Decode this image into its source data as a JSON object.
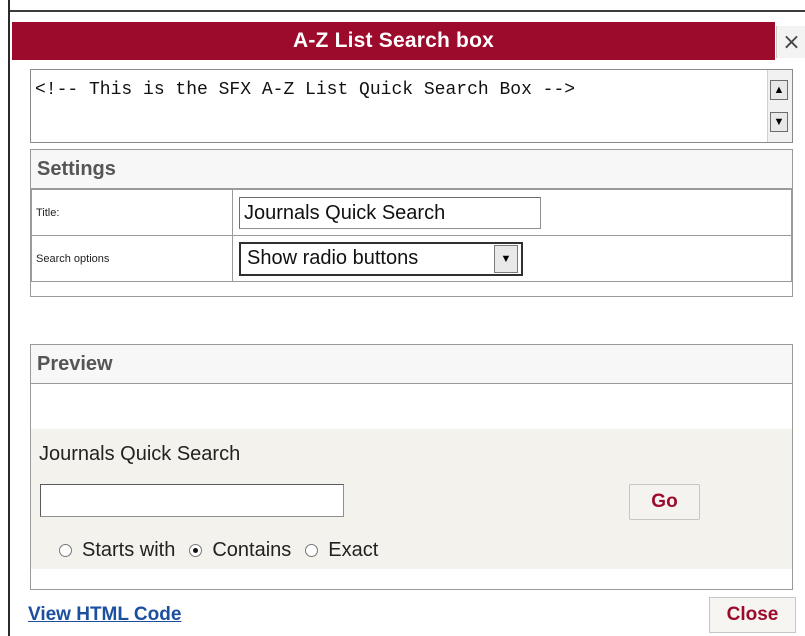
{
  "dialog": {
    "title": "A-Z List Search box",
    "close_glyph": "×"
  },
  "code_area": {
    "text": "<!-- This is the SFX A-Z List Quick Search Box -->",
    "scroll_up_glyph": "▲",
    "scroll_down_glyph": "▼"
  },
  "settings": {
    "heading": "Settings",
    "title_label": "Title:",
    "title_value": "Journals Quick Search",
    "search_options_label": "Search options",
    "search_options_value": "Show radio buttons",
    "dropdown_glyph": "▼"
  },
  "preview": {
    "heading": "Preview",
    "box_title": "Journals Quick Search",
    "search_value": "",
    "go_label": "Go",
    "radios": [
      {
        "label": "Starts with",
        "selected": false
      },
      {
        "label": "Contains",
        "selected": true
      },
      {
        "label": "Exact",
        "selected": false
      }
    ]
  },
  "footer": {
    "view_html_label": "View HTML Code",
    "close_label": "Close"
  },
  "colors": {
    "accent": "#9c0b2c",
    "link": "#1c4fa0"
  }
}
